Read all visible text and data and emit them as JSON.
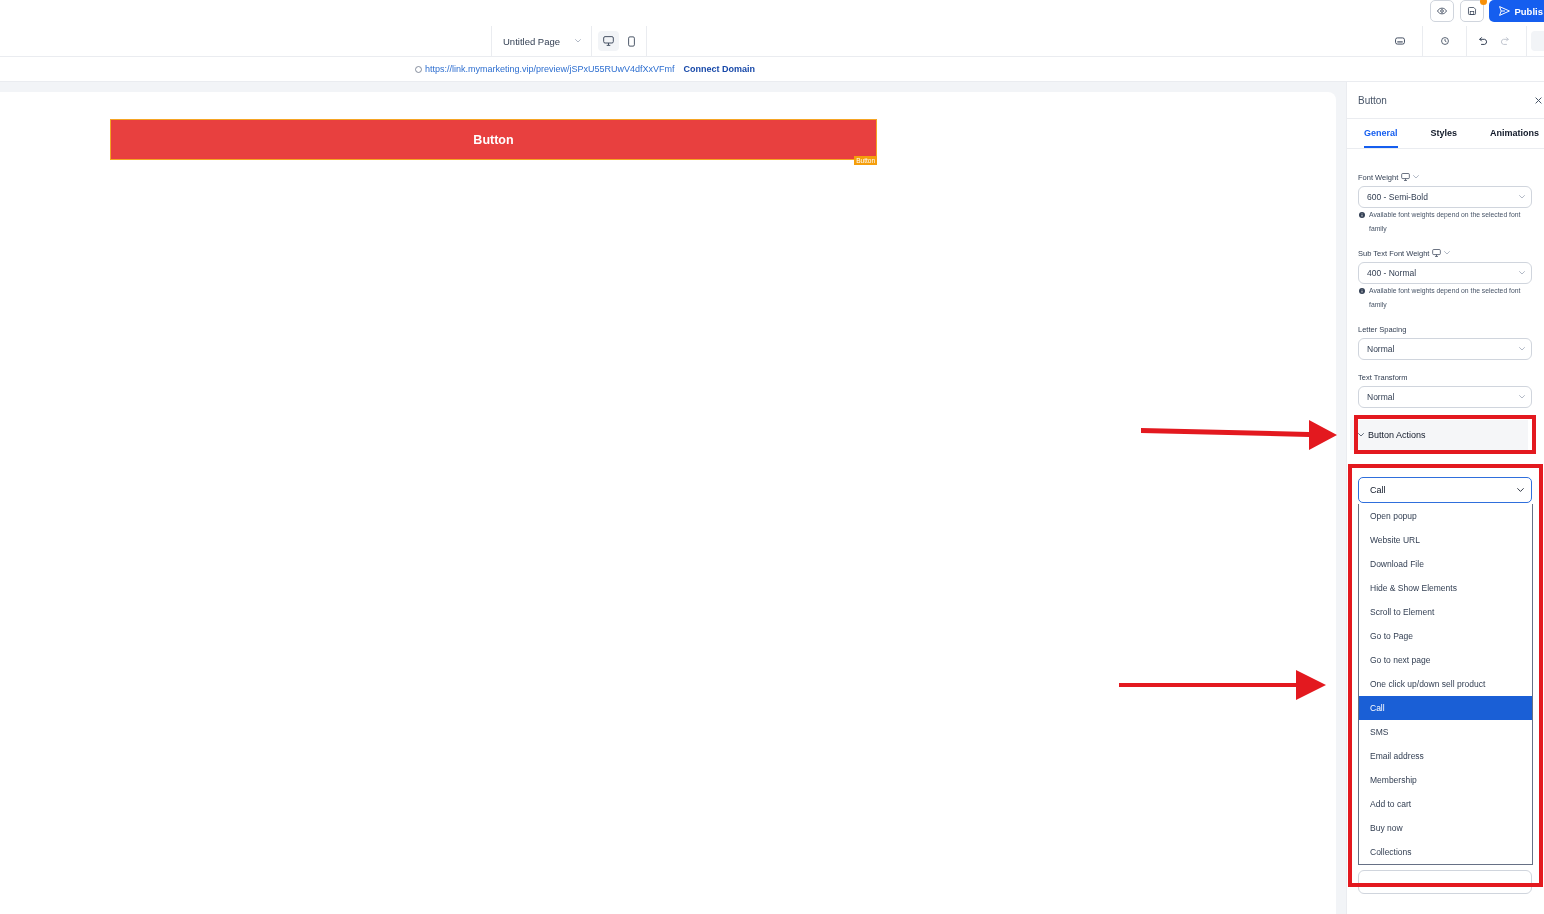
{
  "header": {
    "save": {
      "unsaved_changes": true
    },
    "publish": {
      "label": "Publis"
    },
    "page_selector": {
      "value": "Untitled Page"
    },
    "devices": [
      {
        "kind": "desktop",
        "selected": true
      },
      {
        "kind": "mobile",
        "selected": false
      }
    ],
    "undo": {
      "disabled": false
    },
    "redo": {
      "disabled": true
    }
  },
  "url_bar": {
    "url": "https://link.mymarketing.vip/preview/jSPxU55RUwV4dfXxVFmf",
    "connect_link": "Connect Domain"
  },
  "canvas": {
    "button": {
      "label": "Button",
      "selected": true,
      "tag": "Button"
    }
  },
  "panel": {
    "title": "Button",
    "tabs": [
      {
        "label": "General",
        "selected": true
      },
      {
        "label": "Styles",
        "selected": false
      },
      {
        "label": "Animations",
        "selected": false
      }
    ],
    "fields": [
      {
        "label": "Font Weight",
        "responsive": true,
        "value": "600 - Semi-Bold",
        "note": "Available font weights depend on the selected font family"
      },
      {
        "label": "Sub Text Font Weight",
        "responsive": true,
        "value": "400 - Normal",
        "note": "Available font weights depend on the selected font family"
      },
      {
        "label": "Letter Spacing",
        "responsive": false,
        "value": "Normal"
      },
      {
        "label": "Text Transform",
        "responsive": false,
        "value": "Normal"
      }
    ],
    "button_actions": {
      "title": "Button Actions",
      "expanded": true,
      "highlighted": true
    },
    "link_to": {
      "value": "Call",
      "open": true,
      "highlighted": true,
      "options": [
        {
          "label": "Open popup",
          "selected": false
        },
        {
          "label": "Website URL",
          "selected": false
        },
        {
          "label": "Download File",
          "selected": false
        },
        {
          "label": "Hide & Show Elements",
          "selected": false
        },
        {
          "label": "Scroll to Element",
          "selected": false
        },
        {
          "label": "Go to Page",
          "selected": false
        },
        {
          "label": "Go to next page",
          "selected": false
        },
        {
          "label": "One click up/down sell product",
          "selected": false
        },
        {
          "label": "Call",
          "selected": true
        },
        {
          "label": "SMS",
          "selected": false
        },
        {
          "label": "Email address",
          "selected": false
        },
        {
          "label": "Membership",
          "selected": false
        },
        {
          "label": "Add to cart",
          "selected": false
        },
        {
          "label": "Buy now",
          "selected": false
        },
        {
          "label": "Collections",
          "selected": false
        }
      ]
    }
  }
}
